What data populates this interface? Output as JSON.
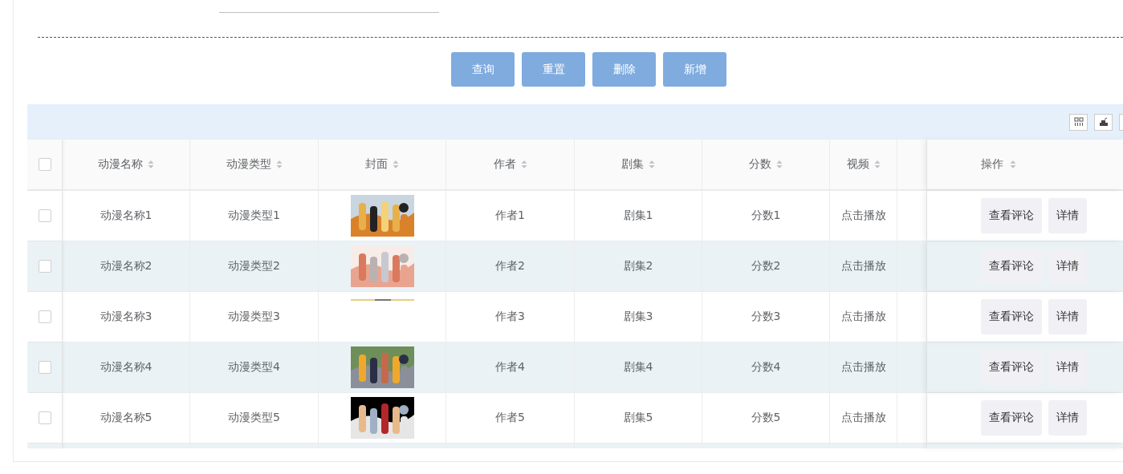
{
  "actions": [
    {
      "label": "查询"
    },
    {
      "label": "重置"
    },
    {
      "label": "删除"
    },
    {
      "label": "新增"
    }
  ],
  "table": {
    "select_all": {
      "checked": false
    },
    "columns": [
      {
        "label": "动漫名称"
      },
      {
        "label": "动漫类型"
      },
      {
        "label": "封面"
      },
      {
        "label": "作者"
      },
      {
        "label": "剧集"
      },
      {
        "label": "分数"
      },
      {
        "label": "视频"
      },
      {},
      {
        "label": "操作"
      }
    ],
    "rows": [
      {
        "checked": false,
        "name": "动漫名称1",
        "type": "动漫类型1",
        "author": "作者1",
        "episodes": "剧集1",
        "score": "分数1",
        "video": "点击播放",
        "buttons": [
          "查看评论",
          "详情"
        ]
      },
      {
        "checked": false,
        "name": "动漫名称2",
        "type": "动漫类型2",
        "author": "作者2",
        "episodes": "剧集2",
        "score": "分数2",
        "video": "点击播放",
        "buttons": [
          "查看评论",
          "详情"
        ]
      },
      {
        "checked": false,
        "name": "动漫名称3",
        "type": "动漫类型3",
        "cover": {
          "kind": "strip"
        },
        "author": "作者3",
        "episodes": "剧集3",
        "score": "分数3",
        "video": "点击播放",
        "buttons": [
          "查看评论",
          "详情"
        ]
      },
      {
        "checked": false,
        "name": "动漫名称4",
        "type": "动漫类型4",
        "author": "作者4",
        "episodes": "剧集4",
        "score": "分数4",
        "video": "点击播放",
        "buttons": [
          "查看评论",
          "详情"
        ]
      },
      {
        "checked": false,
        "name": "动漫名称5",
        "type": "动漫类型5",
        "author": "作者5",
        "episodes": "剧集5",
        "score": "分数5",
        "video": "点击播放",
        "buttons": [
          "查看评论",
          "详情"
        ]
      }
    ]
  }
}
